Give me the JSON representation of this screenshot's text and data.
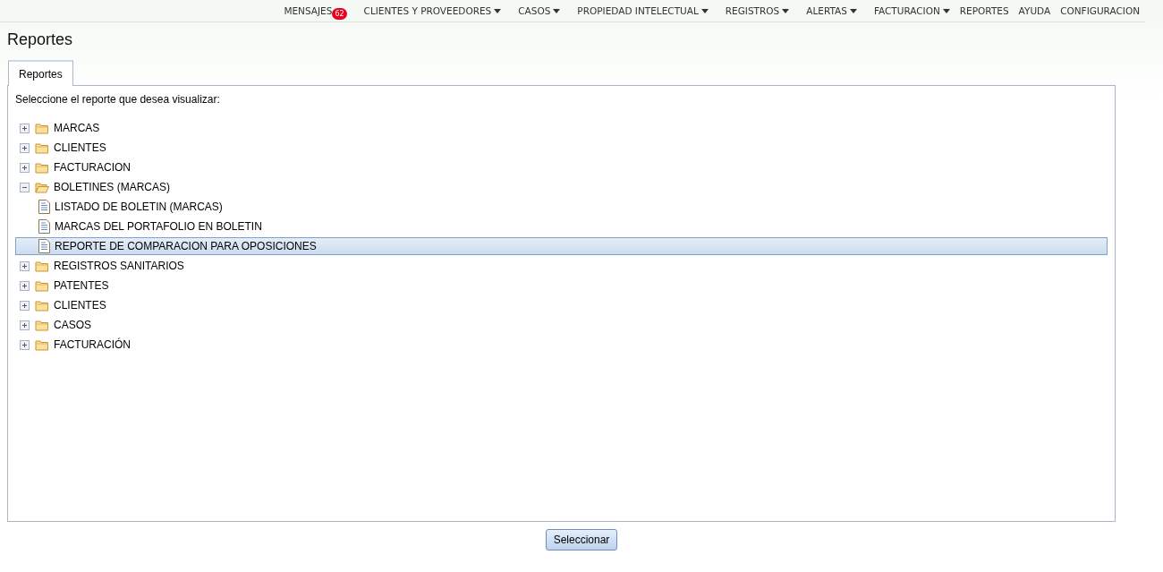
{
  "nav": [
    {
      "label": "MENSAJES",
      "badge": "62",
      "has_menu": false
    },
    {
      "label": "CLIENTES Y PROVEEDORES",
      "has_menu": true
    },
    {
      "label": "CASOS",
      "has_menu": true
    },
    {
      "label": "PROPIEDAD INTELECTUAL",
      "has_menu": true
    },
    {
      "label": "REGISTROS",
      "has_menu": true
    },
    {
      "label": "ALERTAS",
      "has_menu": true
    },
    {
      "label": "FACTURACION",
      "has_menu": true
    },
    {
      "label": "REPORTES",
      "has_menu": false
    },
    {
      "label": "AYUDA",
      "has_menu": false
    },
    {
      "label": "CONFIGURACION",
      "has_menu": false
    }
  ],
  "page_title": "Reportes",
  "tabs": [
    {
      "label": "Reportes",
      "selected": true
    }
  ],
  "prompt": "Seleccione el reporte que desea visualizar:",
  "tree": [
    {
      "kind": "folder",
      "label": "MARCAS",
      "expanded": false,
      "selected": false
    },
    {
      "kind": "folder",
      "label": "CLIENTES",
      "expanded": false,
      "selected": false
    },
    {
      "kind": "folder",
      "label": "FACTURACION",
      "expanded": false,
      "selected": false
    },
    {
      "kind": "folder",
      "label": "BOLETINES (MARCAS)",
      "expanded": true,
      "selected": false,
      "children": [
        {
          "kind": "report",
          "label": "LISTADO DE BOLETIN (MARCAS)",
          "selected": false
        },
        {
          "kind": "report",
          "label": "MARCAS DEL PORTAFOLIO EN BOLETIN",
          "selected": false
        },
        {
          "kind": "report",
          "label": "REPORTE DE COMPARACION PARA OPOSICIONES",
          "selected": true
        }
      ]
    },
    {
      "kind": "folder",
      "label": "REGISTROS SANITARIOS",
      "expanded": false,
      "selected": false
    },
    {
      "kind": "folder",
      "label": "PATENTES",
      "expanded": false,
      "selected": false
    },
    {
      "kind": "folder",
      "label": "CLIENTES",
      "expanded": false,
      "selected": false
    },
    {
      "kind": "folder",
      "label": "CASOS",
      "expanded": false,
      "selected": false
    },
    {
      "kind": "folder",
      "label": "FACTURACIÓN",
      "expanded": false,
      "selected": false
    }
  ],
  "button": "Seleccionar"
}
